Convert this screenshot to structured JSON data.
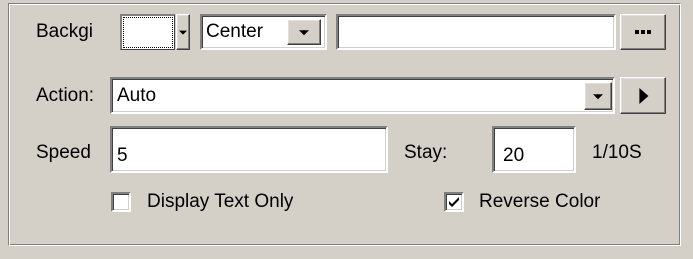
{
  "background": {
    "label": "Backgi",
    "color": "#ffffff",
    "align_value": "Center",
    "image_path_value": ""
  },
  "action": {
    "label": "Action:",
    "value": "Auto"
  },
  "speed": {
    "label": "Speed",
    "value": "5"
  },
  "stay": {
    "label": "Stay:",
    "value": "20",
    "unit": "1/10S"
  },
  "options": {
    "display_text_only": {
      "label": "Display Text Only",
      "checked": false
    },
    "reverse_color": {
      "label": "Reverse Color",
      "checked": true
    }
  },
  "icons": {
    "dropdown": "chevron-down-icon",
    "browse": "ellipsis-icon",
    "play": "play-icon",
    "check": "checkmark-icon"
  }
}
